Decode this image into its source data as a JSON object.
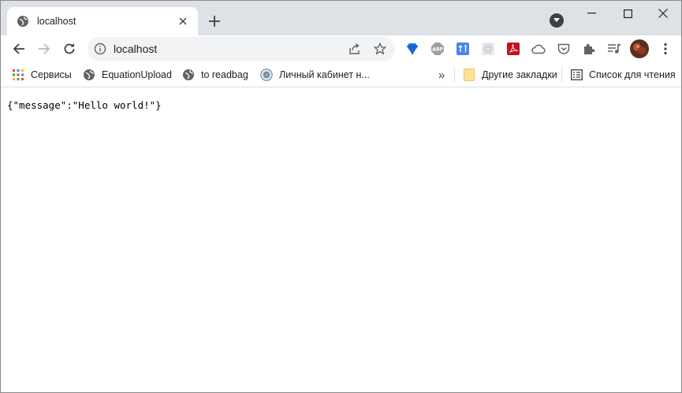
{
  "tab": {
    "title": "localhost"
  },
  "address_bar": {
    "url": "localhost"
  },
  "bookmarks": [
    {
      "label": "Сервисы"
    },
    {
      "label": "EquationUpload"
    },
    {
      "label": "to readbag"
    },
    {
      "label": "Личный кабинет н..."
    }
  ],
  "bookmarks_overflow": "»",
  "other_bookmarks": {
    "label": "Другие закладки"
  },
  "reading_list": {
    "label": "Список для чтения"
  },
  "extensions": {
    "abp_label": "ABP"
  },
  "page": {
    "body_text": "{\"message\":\"Hello world!\"}"
  },
  "colors": {
    "tabstrip": "#dee1e6",
    "omnibox": "#f1f3f4",
    "abp": "#a0a0a0",
    "pdf": "#c4141b",
    "grid_blue": "#1a73e8"
  }
}
